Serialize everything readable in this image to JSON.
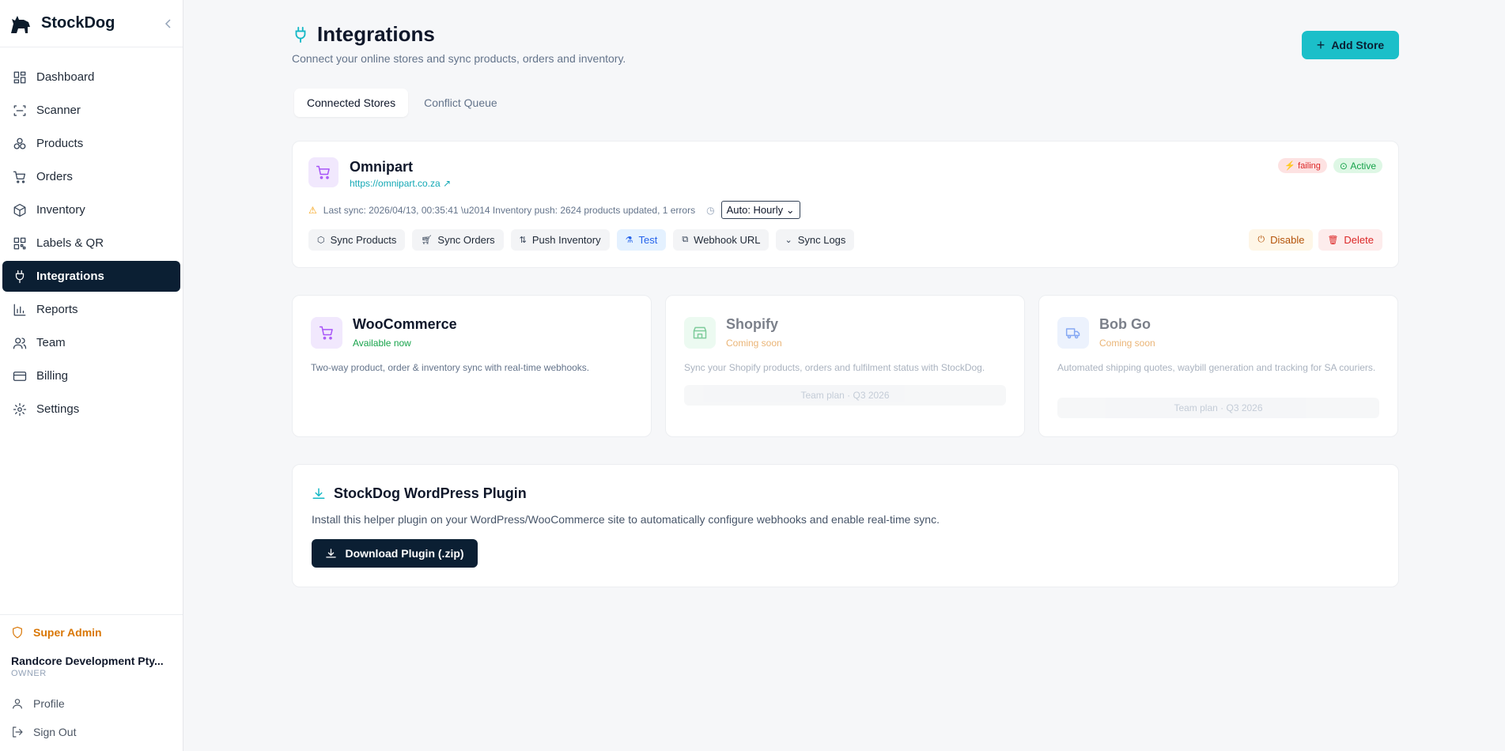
{
  "app": {
    "name": "StockDog"
  },
  "sidebar": {
    "items": [
      {
        "label": "Dashboard",
        "icon": "dashboard-icon"
      },
      {
        "label": "Scanner",
        "icon": "scan-icon"
      },
      {
        "label": "Products",
        "icon": "boxes-icon"
      },
      {
        "label": "Orders",
        "icon": "cart-icon"
      },
      {
        "label": "Inventory",
        "icon": "package-icon"
      },
      {
        "label": "Labels & QR",
        "icon": "qr-icon"
      },
      {
        "label": "Integrations",
        "icon": "plug-icon",
        "active": true
      },
      {
        "label": "Reports",
        "icon": "bar-chart-icon"
      },
      {
        "label": "Team",
        "icon": "users-icon"
      },
      {
        "label": "Billing",
        "icon": "credit-card-icon"
      },
      {
        "label": "Settings",
        "icon": "gear-icon"
      }
    ],
    "admin_label": "Super Admin",
    "org_name": "Randcore Development Pty...",
    "org_role": "OWNER",
    "profile_label": "Profile",
    "signout_label": "Sign Out"
  },
  "page": {
    "title": "Integrations",
    "subtitle": "Connect your online stores and sync products, orders and inventory.",
    "add_store_label": "Add Store",
    "tabs": [
      {
        "label": "Connected Stores",
        "active": true
      },
      {
        "label": "Conflict Queue",
        "active": false
      }
    ]
  },
  "store": {
    "name": "Omnipart",
    "url": "https://omnipart.co.za",
    "badge_failing": "failing",
    "badge_active": "Active",
    "last_sync": "Last sync: 2026/04/13, 00:35:41  \\u2014 Inventory push: 2624 products updated, 1 errors",
    "schedule": "Auto: Hourly",
    "actions": [
      "Sync Products",
      "Sync Orders",
      "Push Inventory",
      "Test",
      "Webhook URL",
      "Sync Logs"
    ],
    "disable_label": "Disable",
    "delete_label": "Delete"
  },
  "integrations": [
    {
      "name": "WooCommerce",
      "status": "Available now",
      "desc": "Two-way product, order & inventory sync with real-time webhooks.",
      "plan": "",
      "color": "#a855f7",
      "bg": "#f1e8fd",
      "status_color": "#16a34a"
    },
    {
      "name": "Shopify",
      "status": "Coming soon",
      "desc": "Sync your Shopify products, orders and fulfilment status with StockDog.",
      "plan": "Team plan · Q3 2026",
      "color": "#16a34a",
      "bg": "#ddf6e6",
      "status_color": "#d97706"
    },
    {
      "name": "Bob Go",
      "status": "Coming soon",
      "desc": "Automated shipping quotes, waybill generation and tracking for SA couriers.",
      "plan": "Team plan · Q3 2026",
      "color": "#2563eb",
      "bg": "#dde9fd",
      "status_color": "#d97706"
    }
  ],
  "plugin": {
    "title": "StockDog WordPress Plugin",
    "desc": "Install this helper plugin on your WordPress/WooCommerce site to automatically configure webhooks and enable real-time sync.",
    "button_label": "Download Plugin (.zip)"
  }
}
